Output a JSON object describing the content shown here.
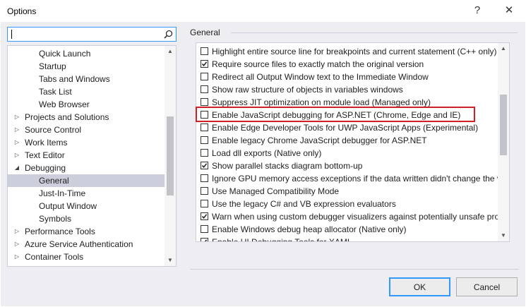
{
  "window": {
    "title": "Options",
    "help_glyph": "?",
    "close_glyph": "✕"
  },
  "search": {
    "value": "",
    "placeholder": ""
  },
  "tree": {
    "items": [
      {
        "label": "Quick Launch",
        "level": 2,
        "expander": "none"
      },
      {
        "label": "Startup",
        "level": 2,
        "expander": "none"
      },
      {
        "label": "Tabs and Windows",
        "level": 2,
        "expander": "none"
      },
      {
        "label": "Task List",
        "level": 2,
        "expander": "none"
      },
      {
        "label": "Web Browser",
        "level": 2,
        "expander": "none"
      },
      {
        "label": "Projects and Solutions",
        "level": 1,
        "expander": "collapsed"
      },
      {
        "label": "Source Control",
        "level": 1,
        "expander": "collapsed"
      },
      {
        "label": "Work Items",
        "level": 1,
        "expander": "collapsed"
      },
      {
        "label": "Text Editor",
        "level": 1,
        "expander": "collapsed"
      },
      {
        "label": "Debugging",
        "level": 1,
        "expander": "expanded"
      },
      {
        "label": "General",
        "level": 2,
        "expander": "none",
        "selected": true
      },
      {
        "label": "Just-In-Time",
        "level": 2,
        "expander": "none"
      },
      {
        "label": "Output Window",
        "level": 2,
        "expander": "none"
      },
      {
        "label": "Symbols",
        "level": 2,
        "expander": "none"
      },
      {
        "label": "Performance Tools",
        "level": 1,
        "expander": "collapsed"
      },
      {
        "label": "Azure Service Authentication",
        "level": 1,
        "expander": "collapsed"
      },
      {
        "label": "Container Tools",
        "level": 1,
        "expander": "collapsed"
      }
    ],
    "scroll_position": 0.5
  },
  "section": {
    "title": "General"
  },
  "options": [
    {
      "label": "Highlight entire source line for breakpoints and current statement (C++ only)",
      "checked": false
    },
    {
      "label": "Require source files to exactly match the original version",
      "checked": true
    },
    {
      "label": "Redirect all Output Window text to the Immediate Window",
      "checked": false
    },
    {
      "label": "Show raw structure of objects in variables windows",
      "checked": false
    },
    {
      "label": "Suppress JIT optimization on module load (Managed only)",
      "checked": false
    },
    {
      "label": "Enable JavaScript debugging for ASP.NET (Chrome, Edge and IE)",
      "checked": false,
      "highlighted": true
    },
    {
      "label": "Enable Edge Developer Tools for UWP JavaScript Apps (Experimental)",
      "checked": false
    },
    {
      "label": "Enable legacy Chrome JavaScript debugger for ASP.NET",
      "checked": false
    },
    {
      "label": "Load dll exports (Native only)",
      "checked": false
    },
    {
      "label": "Show parallel stacks diagram bottom-up",
      "checked": true
    },
    {
      "label": "Ignore GPU memory access exceptions if the data written didn't change the value",
      "checked": false
    },
    {
      "label": "Use Managed Compatibility Mode",
      "checked": false
    },
    {
      "label": "Use the legacy C# and VB expression evaluators",
      "checked": false
    },
    {
      "label": "Warn when using custom debugger visualizers against potentially unsafe processes",
      "checked": true
    },
    {
      "label": "Enable Windows debug heap allocator (Native only)",
      "checked": false
    },
    {
      "label": "Enable UI Debugging Tools for XAML",
      "checked": true
    }
  ],
  "options_scroll_position": 0.35,
  "buttons": {
    "ok": "OK",
    "cancel": "Cancel"
  },
  "colors": {
    "highlight_border": "#d11f26",
    "focus_border": "#3399ff",
    "selected_row": "#cccedb"
  }
}
